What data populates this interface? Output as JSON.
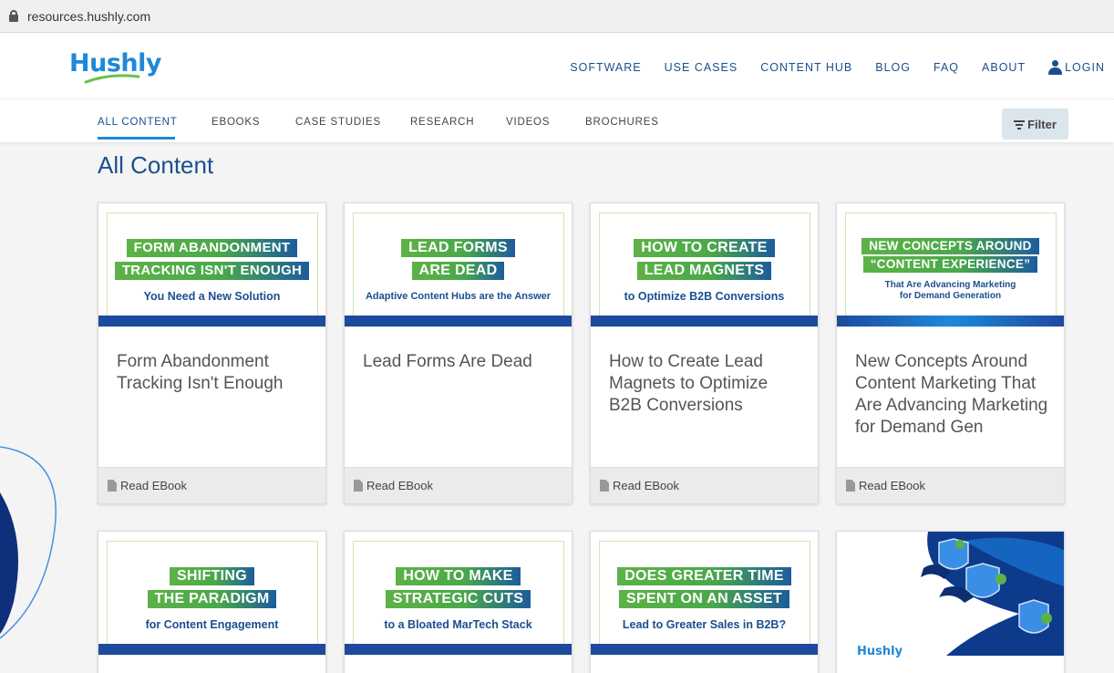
{
  "browser": {
    "url": "resources.hushly.com"
  },
  "header": {
    "logo": "Hushly",
    "nav": [
      "SOFTWARE",
      "USE CASES",
      "CONTENT HUB",
      "BLOG",
      "FAQ",
      "ABOUT"
    ],
    "login": "LOGIN"
  },
  "subnav": {
    "tabs": [
      "ALL CONTENT",
      "EBOOKS",
      "CASE STUDIES",
      "RESEARCH",
      "VIDEOS",
      "BROCHURES"
    ],
    "active_tab": "ALL CONTENT",
    "filter_label": "Filter"
  },
  "page_title": "All Content",
  "colors": {
    "brand_blue": "#1a4f8f",
    "accent_blue": "#1e88d8",
    "green": "#5db246",
    "band_blue": "#1d4a9c"
  },
  "cards": [
    {
      "thumb_lines": [
        "FORM ABANDONMENT",
        "TRACKING ISN'T ENOUGH"
      ],
      "thumb_sub": "You Need a New Solution",
      "title": "Form Abandonment Tracking Isn't Enough",
      "action": "Read EBook"
    },
    {
      "thumb_lines": [
        "LEAD FORMS",
        "ARE DEAD"
      ],
      "thumb_sub": "Adaptive Content Hubs are the Answer",
      "title": "Lead Forms Are Dead",
      "action": "Read EBook"
    },
    {
      "thumb_lines": [
        "HOW TO CREATE",
        "LEAD MAGNETS"
      ],
      "thumb_sub": "to Optimize B2B Conversions",
      "title": "How to Create Lead Magnets to Optimize B2B Conversions",
      "action": "Read EBook"
    },
    {
      "thumb_lines": [
        "NEW CONCEPTS AROUND",
        "“CONTENT EXPERIENCE”"
      ],
      "thumb_sub": "That Are Advancing Marketing",
      "thumb_sub2": "for Demand Generation",
      "title": "New Concepts Around Content Marketing That Are Advancing Marketing for Demand Gen",
      "action": "Read EBook"
    },
    {
      "thumb_lines": [
        "SHIFTING",
        "THE PARADIGM"
      ],
      "thumb_sub": "for Content Engagement"
    },
    {
      "thumb_lines": [
        "HOW TO MAKE",
        "STRATEGIC CUTS"
      ],
      "thumb_sub": "to a Bloated MarTech Stack"
    },
    {
      "thumb_lines": [
        "DOES GREATER TIME",
        "SPENT ON AN ASSET"
      ],
      "thumb_sub": "Lead to Greater Sales in B2B?"
    },
    {
      "thumb_brand": "Hushly"
    }
  ]
}
